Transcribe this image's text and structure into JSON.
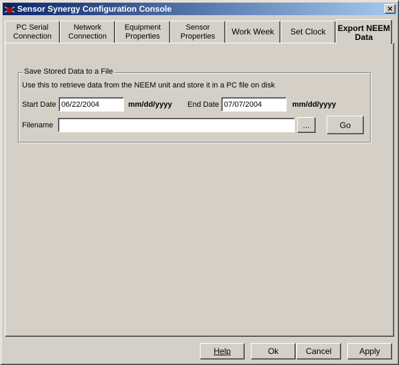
{
  "window": {
    "title": "Sensor Synergy Configuration Console",
    "close_label": "×"
  },
  "tabs": [
    {
      "line1": "PC Serial",
      "line2": "Connection"
    },
    {
      "line1": "Network",
      "line2": "Connection"
    },
    {
      "line1": "Equipment",
      "line2": "Properties"
    },
    {
      "line1": "Sensor",
      "line2": "Properties"
    },
    {
      "line1": "Work Week",
      "line2": ""
    },
    {
      "line1": "Set Clock",
      "line2": ""
    },
    {
      "line1": "Export NEEM",
      "line2": "Data",
      "active": true
    }
  ],
  "export_group": {
    "title": "Save Stored Data to a File",
    "description": "Use this to retrieve data from the NEEM unit and store it in a PC file on disk",
    "start_date_label": "Start Date",
    "start_date_value": "06/22/2004",
    "start_date_format": "mm/dd/yyyy",
    "end_date_label": "End Date",
    "end_date_value": "07/07/2004",
    "end_date_format": "mm/dd/yyyy",
    "filename_label": "Filename",
    "filename_value": "",
    "browse_label": "...",
    "go_label": "Go"
  },
  "footer": {
    "help_label": "Help",
    "ok_label": "Ok",
    "cancel_label": "Cancel",
    "apply_label": "Apply"
  }
}
